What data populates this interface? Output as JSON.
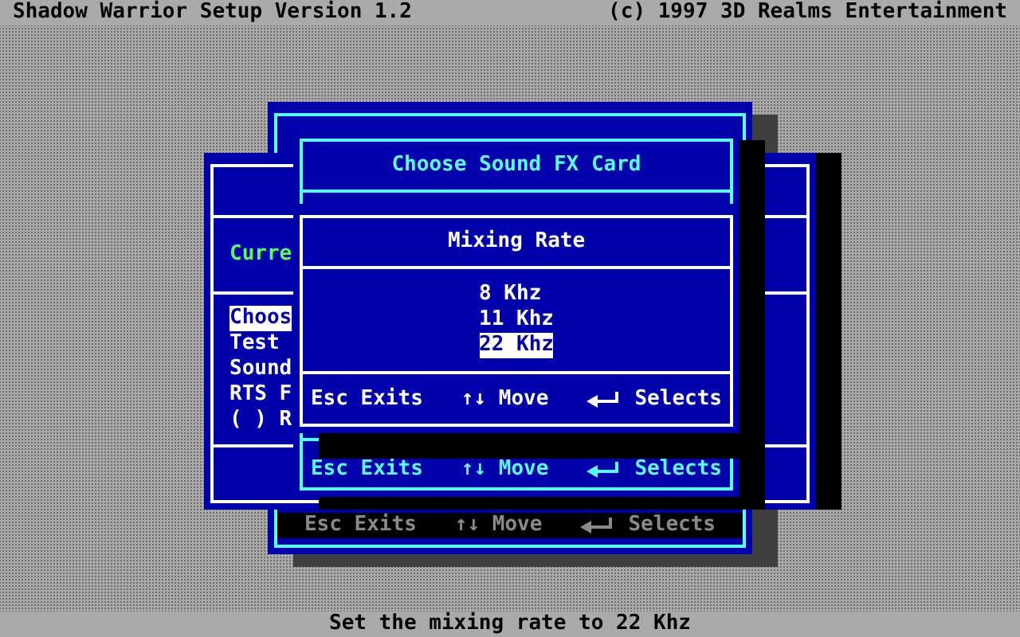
{
  "header": {
    "title": "Shadow Warrior Setup Version 1.2",
    "copyright": "(c) 1997 3D Realms Entertainment"
  },
  "back_window": {
    "hints": [
      "Esc Exits",
      "↑↓ Move",
      "Selects"
    ]
  },
  "main_menu": {
    "current_label": "Curre",
    "items": [
      {
        "label": "Choos",
        "selected": true
      },
      {
        "label": "Test",
        "selected": false
      },
      {
        "label": "Sound",
        "selected": false
      },
      {
        "label": "RTS F",
        "selected": false
      },
      {
        "label": "( ) R",
        "selected": false
      }
    ]
  },
  "sound_card_dialog": {
    "title": "Choose Sound FX Card",
    "hints": [
      "Esc Exits",
      "↑↓ Move",
      "Selects"
    ]
  },
  "mixing_rate_dialog": {
    "title": "Mixing Rate",
    "options": [
      {
        "label": "8 Khz",
        "selected": false
      },
      {
        "label": "11 Khz",
        "selected": false
      },
      {
        "label": "22 Khz",
        "selected": true
      }
    ],
    "hints": [
      "Esc Exits",
      "↑↓ Move",
      "Selects"
    ]
  },
  "status_bar": "Set the mixing rate to 22 Khz"
}
